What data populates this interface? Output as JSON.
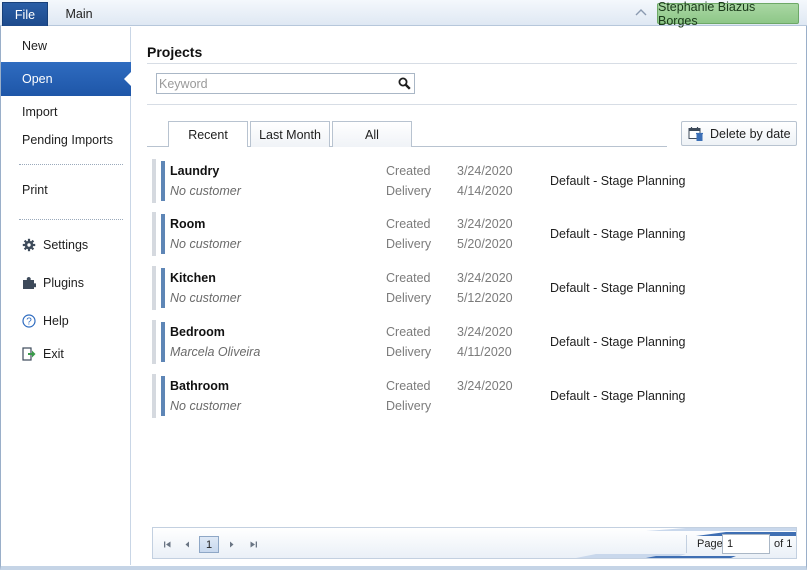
{
  "ribbon": {
    "file_tab": "File",
    "main_tab": "Main",
    "user": "Stephanie Biazus Borges"
  },
  "sidebar": {
    "items": [
      {
        "label": "New"
      },
      {
        "label": "Open",
        "active": true
      },
      {
        "label": "Import"
      },
      {
        "label": "Pending Imports"
      },
      {
        "label": "Print"
      },
      {
        "label": "Settings",
        "icon": "gear-icon"
      },
      {
        "label": "Plugins",
        "icon": "puzzle-icon"
      },
      {
        "label": "Help",
        "icon": "help-icon"
      },
      {
        "label": "Exit",
        "icon": "exit-icon"
      }
    ]
  },
  "projects": {
    "title": "Projects",
    "search_placeholder": "Keyword",
    "tabs": [
      "Recent",
      "Last Month",
      "All"
    ],
    "delete_by_date": "Delete by date",
    "created_label": "Created",
    "delivery_label": "Delivery",
    "rows": [
      {
        "name": "Laundry",
        "customer": "No customer",
        "created": "3/24/2020",
        "delivery": "4/14/2020",
        "workflow": "Default - Stage Planning"
      },
      {
        "name": "Room",
        "customer": "No customer",
        "created": "3/24/2020",
        "delivery": "5/20/2020",
        "workflow": "Default - Stage Planning"
      },
      {
        "name": "Kitchen",
        "customer": "No customer",
        "created": "3/24/2020",
        "delivery": "5/12/2020",
        "workflow": "Default - Stage Planning"
      },
      {
        "name": "Bedroom",
        "customer": "Marcela Oliveira",
        "created": "3/24/2020",
        "delivery": "4/11/2020",
        "workflow": "Default - Stage Planning"
      },
      {
        "name": "Bathroom",
        "customer": "No customer",
        "created": "3/24/2020",
        "delivery": "",
        "workflow": "Default - Stage Planning"
      }
    ]
  },
  "pager": {
    "current_page_button": "1",
    "page_label": "Page",
    "page_value": "1",
    "of_label": "of 1"
  },
  "colors": {
    "accent": "#1e56a8",
    "user_badge": "#9fd19a",
    "row_bar": "#5e86b6"
  }
}
